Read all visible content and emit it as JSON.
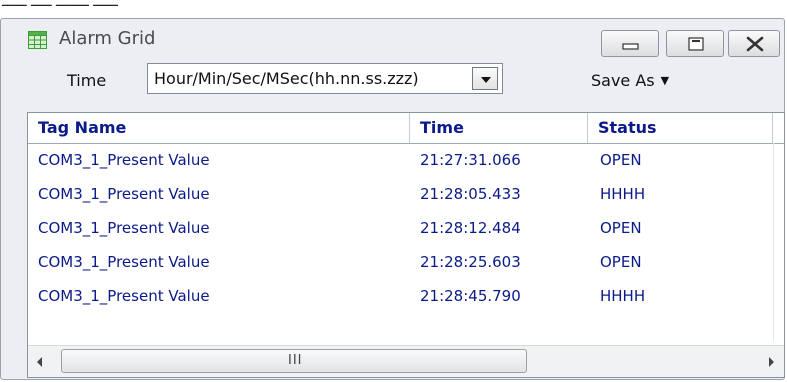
{
  "window": {
    "title": "Alarm Grid"
  },
  "toolbar": {
    "time_label": "Time",
    "time_format": "Hour/Min/Sec/MSec(hh.nn.ss.zzz)",
    "save_as_label": "Save As"
  },
  "grid": {
    "columns": [
      "Tag Name",
      "Time",
      "Status"
    ],
    "rows": [
      {
        "tag": "COM3_1_Present Value",
        "time": "21:27:31.066",
        "status": "OPEN"
      },
      {
        "tag": "COM3_1_Present Value",
        "time": "21:28:05.433",
        "status": "HHHH"
      },
      {
        "tag": "COM3_1_Present Value",
        "time": "21:28:12.484",
        "status": "OPEN"
      },
      {
        "tag": "COM3_1_Present Value",
        "time": "21:28:25.603",
        "status": "OPEN"
      },
      {
        "tag": "COM3_1_Present Value",
        "time": "21:28:45.790",
        "status": "HHHH"
      }
    ]
  },
  "colors": {
    "header_text": "#0b1a8a",
    "window_bg": "#eceef3",
    "grid_border": "#8894a3"
  },
  "icons": {
    "app": "grid-icon",
    "minimize": "minimize-icon",
    "maximize": "maximize-icon",
    "close": "close-icon",
    "dropdown": "chevron-down-icon",
    "scroll_left": "arrow-left-icon",
    "scroll_right": "arrow-right-icon"
  }
}
